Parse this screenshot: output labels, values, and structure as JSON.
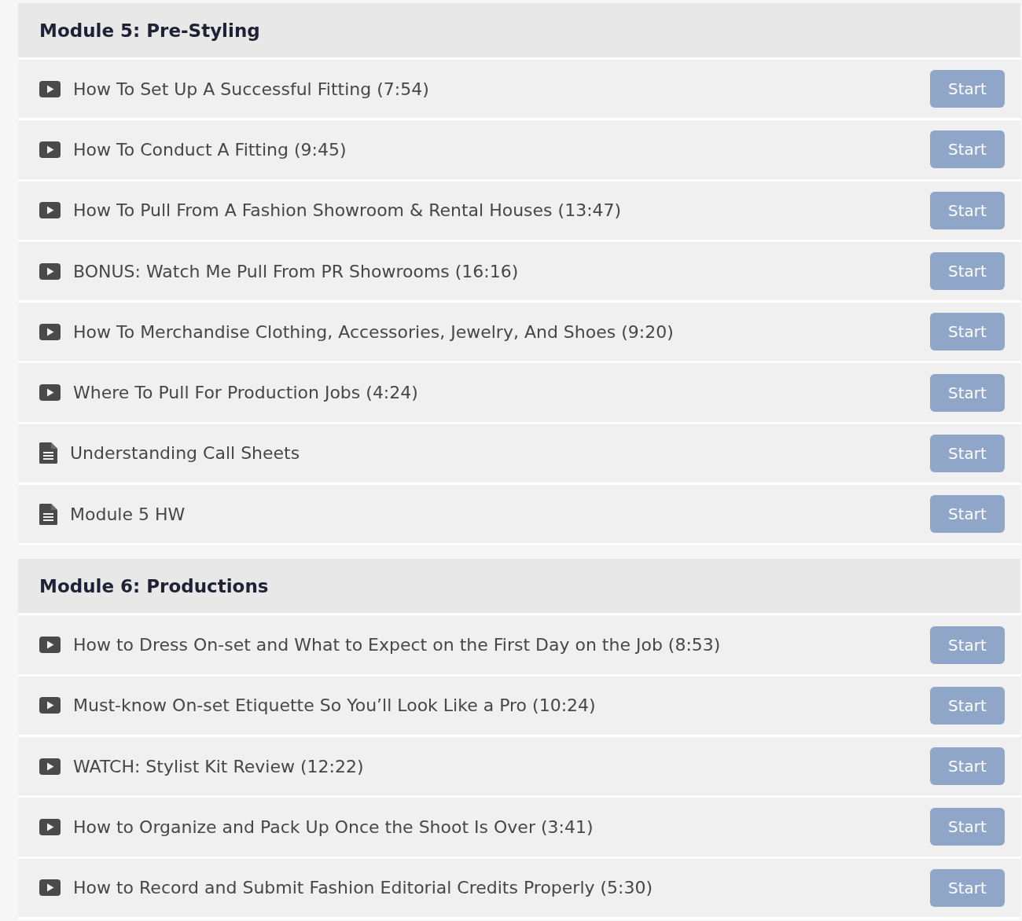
{
  "modules": [
    {
      "title": "Module 5: Pre-Styling",
      "lessons": [
        {
          "kind": "video",
          "title": "How To Set Up A Successful Fitting (7:54)",
          "button": "Start"
        },
        {
          "kind": "video",
          "title": "How To Conduct A Fitting (9:45)",
          "button": "Start"
        },
        {
          "kind": "video",
          "title": "How To Pull From A Fashion Showroom & Rental Houses (13:47)",
          "button": "Start"
        },
        {
          "kind": "video",
          "title": "BONUS: Watch Me Pull From PR Showrooms (16:16)",
          "button": "Start"
        },
        {
          "kind": "video",
          "title": "How To Merchandise Clothing, Accessories, Jewelry, And Shoes (9:20)",
          "button": "Start"
        },
        {
          "kind": "video",
          "title": "Where To Pull For Production Jobs (4:24)",
          "button": "Start"
        },
        {
          "kind": "document",
          "title": "Understanding Call Sheets",
          "button": "Start"
        },
        {
          "kind": "document",
          "title": "Module 5 HW",
          "button": "Start"
        }
      ]
    },
    {
      "title": "Module 6: Productions",
      "lessons": [
        {
          "kind": "video",
          "title": "How to Dress On-set and What to Expect on the First Day on the Job (8:53)",
          "button": "Start"
        },
        {
          "kind": "video",
          "title": "Must-know On-set Etiquette So You’ll Look Like a Pro (10:24)",
          "button": "Start"
        },
        {
          "kind": "video",
          "title": "WATCH: Stylist Kit Review (12:22)",
          "button": "Start"
        },
        {
          "kind": "video",
          "title": "How to Organize and Pack Up Once the Shoot Is Over (3:41)",
          "button": "Start"
        },
        {
          "kind": "video",
          "title": "How to Record and Submit Fashion Editorial Credits Properly (5:30)",
          "button": "Start"
        }
      ]
    }
  ]
}
